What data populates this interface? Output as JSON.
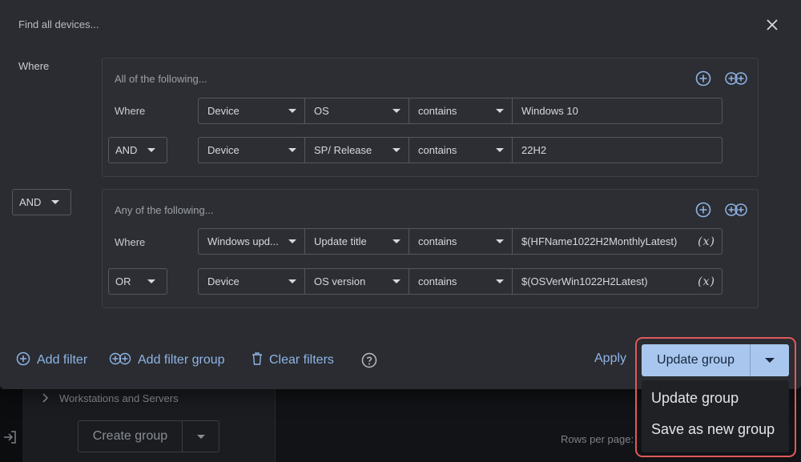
{
  "background": {
    "tree_item": "Workstations and Servers",
    "create_group_label": "Create group",
    "rows_per_page_label": "Rows per page:"
  },
  "modal": {
    "title": "Find all devices...",
    "outer_where": "Where",
    "between_groups_operator": "AND",
    "groups": [
      {
        "title": "All of the following...",
        "rows": [
          {
            "connector": "Where",
            "field1": "Device",
            "field2": "OS",
            "operator": "contains",
            "value": "Windows 10",
            "has_fx": false
          },
          {
            "connector": "AND",
            "field1": "Device",
            "field2": "SP/ Release",
            "operator": "contains",
            "value": "22H2",
            "has_fx": false
          }
        ]
      },
      {
        "title": "Any of the following...",
        "rows": [
          {
            "connector": "Where",
            "field1": "Windows upd...",
            "field2": "Update title",
            "operator": "contains",
            "value": "$(HFName1022H2MonthlyLatest)",
            "has_fx": true
          },
          {
            "connector": "OR",
            "field1": "Device",
            "field2": "OS version",
            "operator": "contains",
            "value": "$(OSVerWin1022H2Latest)",
            "has_fx": true
          }
        ]
      }
    ],
    "fx_symbol": "(x)",
    "footer": {
      "add_filter": "Add filter",
      "add_filter_group": "Add filter group",
      "clear_filters": "Clear filters",
      "apply": "Apply",
      "update_group": "Update group"
    },
    "menu": [
      "Update group",
      "Save as new group"
    ]
  },
  "colors": {
    "accent": "#8fb4e6",
    "primary_button": "#a9c7ee",
    "highlight": "#e05a5a",
    "modal_bg": "#2a2c31"
  }
}
